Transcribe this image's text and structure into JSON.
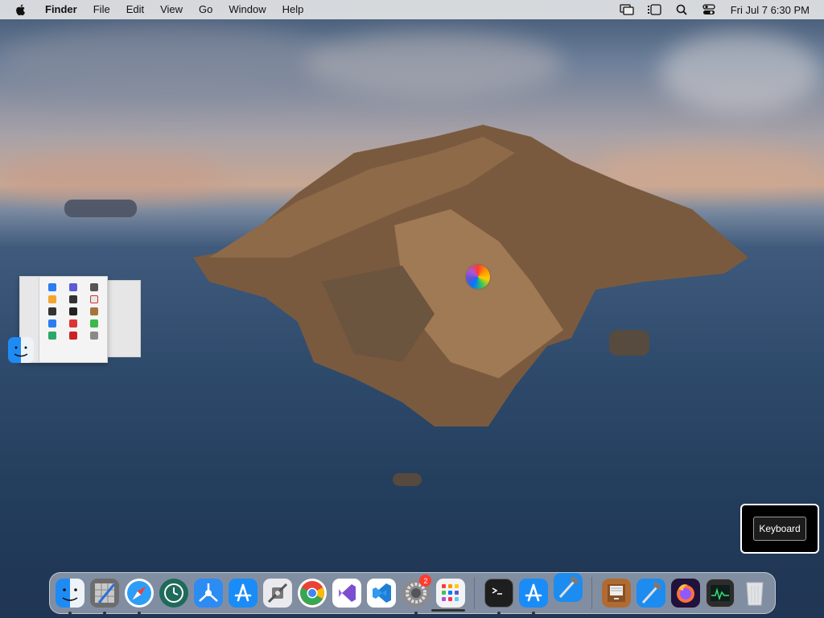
{
  "menubar": {
    "app_name": "Finder",
    "menus": [
      "File",
      "Edit",
      "View",
      "Go",
      "Window",
      "Help"
    ],
    "clock": "Fri Jul 7  6:30 PM"
  },
  "dock": {
    "badge_system_preferences": "2"
  },
  "keyboard_overlay": {
    "button_label": "Keyboard"
  },
  "colors": {
    "accent": "#007aff",
    "badge": "#ff3b30"
  }
}
